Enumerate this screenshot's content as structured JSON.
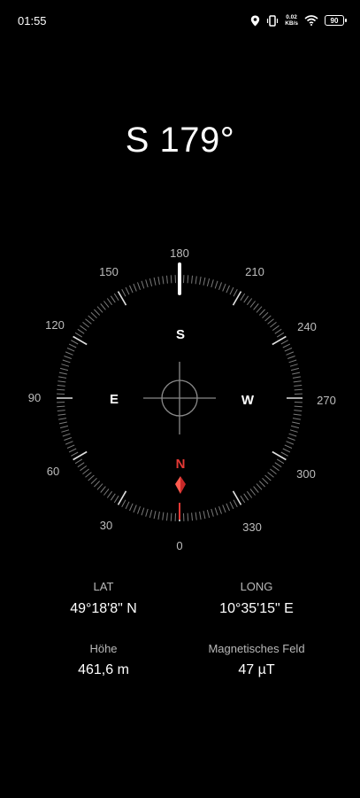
{
  "status_bar": {
    "time": "01:55",
    "network_speed_value": "0.02",
    "network_speed_unit": "KB/s",
    "battery": "90",
    "icons": [
      "location-icon",
      "vibrate-icon",
      "wifi-icon",
      "battery-icon"
    ]
  },
  "heading": "S 179°",
  "compass": {
    "heading_degrees": 179,
    "degree_labels": {
      "d0": "0",
      "d30": "30",
      "d60": "60",
      "d90": "90",
      "d120": "120",
      "d150": "150",
      "d180": "180",
      "d210": "210",
      "d240": "240",
      "d270": "270",
      "d300": "300",
      "d330": "330"
    },
    "cardinals": {
      "north": "N",
      "south": "S",
      "east": "E",
      "west": "W"
    },
    "colors": {
      "north": "#e53935",
      "dial": "#ffffff",
      "background": "#000000"
    }
  },
  "info": {
    "lat_label": "LAT",
    "lat_value": "49°18'8\" N",
    "long_label": "LONG",
    "long_value": "10°35'15\" E",
    "altitude_label": "Höhe",
    "altitude_value": "461,6 m",
    "magnetic_label": "Magnetisches Feld",
    "magnetic_value": "47 µT"
  }
}
